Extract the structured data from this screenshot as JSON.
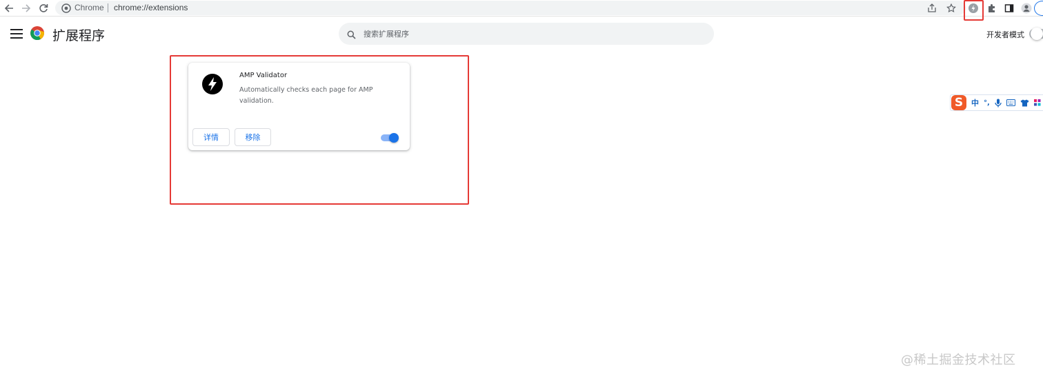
{
  "browser": {
    "site_name": "Chrome",
    "url": "chrome://extensions"
  },
  "header": {
    "title": "扩展程序",
    "search_placeholder": "搜索扩展程序",
    "dev_mode_label": "开发者模式",
    "dev_mode_on": false
  },
  "extension": {
    "name": "AMP Validator",
    "description": "Automatically checks each page for AMP validation.",
    "details_label": "详情",
    "remove_label": "移除",
    "enabled": true
  },
  "ime": {
    "logo": "S",
    "mode": "中",
    "punct": "°,"
  },
  "watermark": "@稀土掘金技术社区",
  "colors": {
    "accent": "#1a73e8",
    "annotation": "#e53935",
    "ime_brand": "#f05a28"
  }
}
